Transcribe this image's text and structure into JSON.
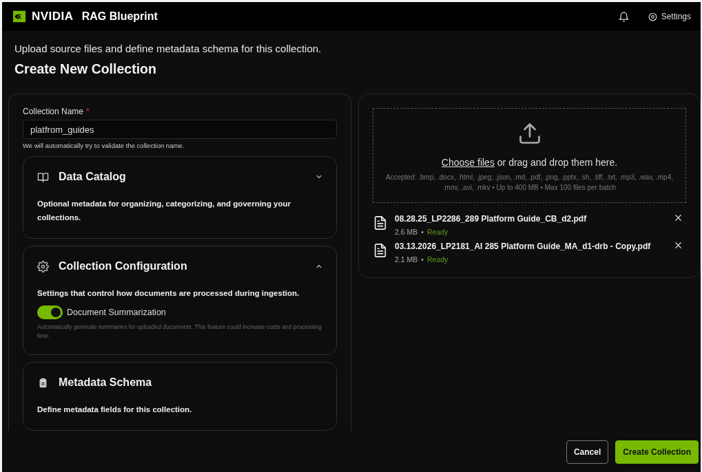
{
  "header": {
    "brand": "NVIDIA",
    "title": "RAG Blueprint",
    "settings": "Settings"
  },
  "page": {
    "subtitle": "Upload source files and define metadata schema for this collection.",
    "title": "Create New Collection"
  },
  "name_field": {
    "label": "Collection Name",
    "required": "*",
    "value": "platfrom_guides",
    "hint": "We will automatically try to validate the collection name."
  },
  "sections": [
    {
      "kind": "catalog",
      "title": "Data Catalog",
      "expanded": false,
      "description": "Optional metadata for organizing, categorizing, and governing your collections."
    },
    {
      "kind": "config",
      "title": "Collection Configuration",
      "expanded": true,
      "description": "Settings that control how documents are processed during ingestion.",
      "toggle": {
        "label": "Document Summarization",
        "on": true,
        "help": "Automatically generate summaries for uploaded documents. This feature could increase costs and processing time."
      }
    },
    {
      "kind": "schema",
      "title": "Metadata Schema",
      "description": "Define metadata fields for this collection."
    }
  ],
  "upload": {
    "link": "Choose files",
    "text": "or drag and drop them here.",
    "accepted": "Accepted: .bmp, .docx, .html, .jpeg, .json, .md, .pdf, .png, .pptx, .sh, .tiff, .txt, .mp3, .wav, .mp4, .mov, .avi, .mkv • Up to 400 MB • Max 100 files per batch"
  },
  "files": [
    {
      "name": "08.28.25_LP2286_289 Platform Guide_CB_d2.pdf",
      "size": "2.6 MB",
      "separator": "•",
      "status": "Ready"
    },
    {
      "name": "03.13.2026_LP2181_AI 285 Platform Guide_MA_d1-drb - Copy.pdf",
      "size": "2.1 MB",
      "separator": "•",
      "status": "Ready"
    }
  ],
  "buttons": {
    "cancel": "Cancel",
    "create": "Create Collection"
  }
}
